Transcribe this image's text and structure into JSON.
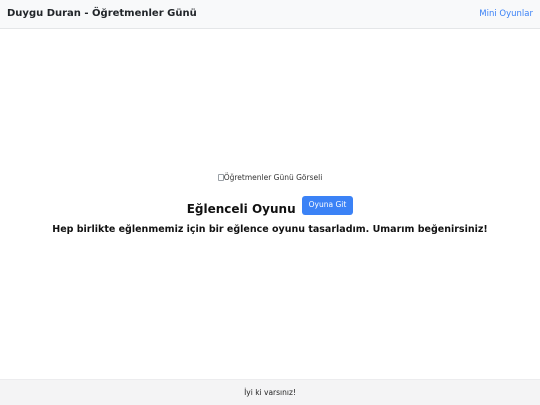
{
  "navbar": {
    "brand": "Duygu Duran - Öğretmenler Günü",
    "link_label": "Mini Oyunlar"
  },
  "main": {
    "image_alt": "Öğretmenler Günü Görseli",
    "image_icon": "broken-image-icon",
    "game_title": "Eğlenceli Oyunu",
    "game_button": "Oyuna Git",
    "subtitle": "Hep birlikte eğlenmemiz için bir eğlence oyunu tasarladım. Umarım beğenirsiniz!"
  },
  "footer": {
    "text": "İyi ki varsınız!"
  },
  "colors": {
    "accent": "#3b82f6",
    "navbar_bg": "#f8f9fa",
    "footer_bg": "#f4f4f5"
  }
}
